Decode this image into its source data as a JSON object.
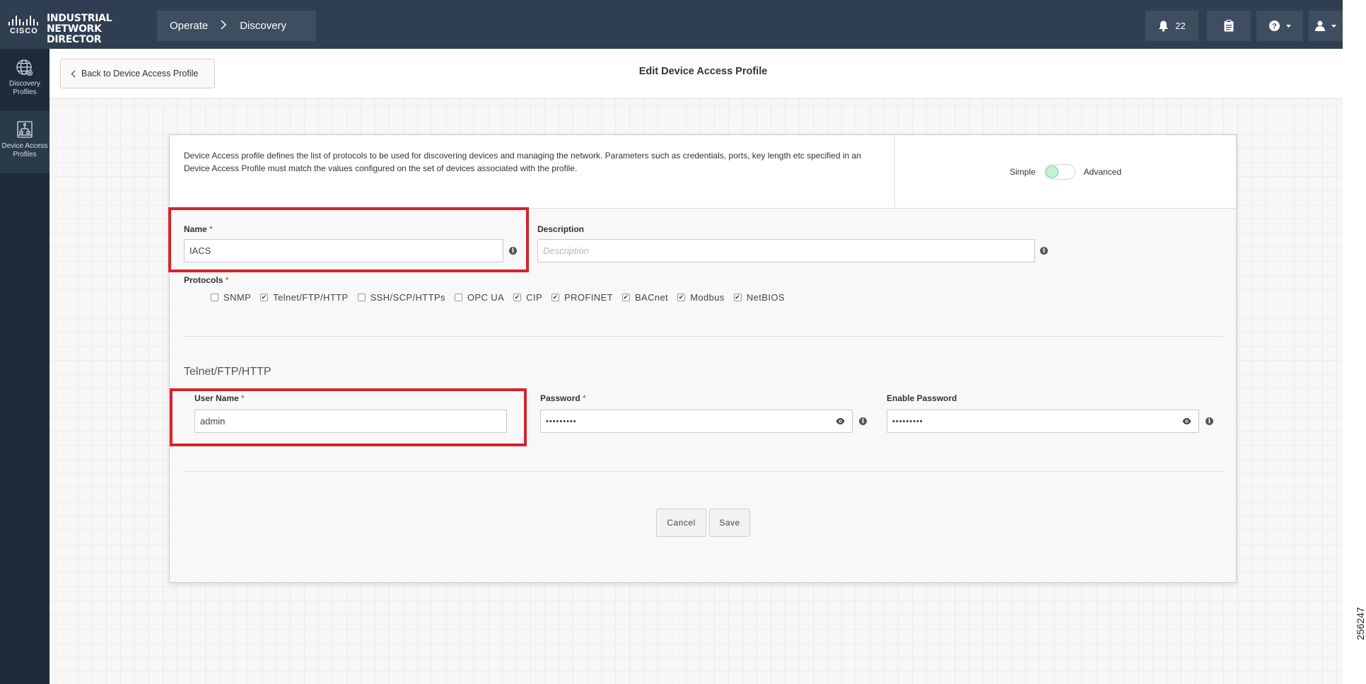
{
  "header": {
    "logo_brand": "CISCO",
    "logo_product_line1": "INDUSTRIAL",
    "logo_product_line2": "NETWORK DIRECTOR",
    "breadcrumb": [
      "Operate",
      "Discovery"
    ],
    "notifications_count": "22",
    "icons": [
      "bell-icon",
      "clipboard-icon",
      "help-icon",
      "user-icon"
    ]
  },
  "sidebar": {
    "items": [
      {
        "label_line1": "Discovery",
        "label_line2": "Profiles",
        "icon": "globe-icon",
        "active": false
      },
      {
        "label_line1": "Device Access",
        "label_line2": "Profiles",
        "icon": "device-icon",
        "active": true
      }
    ]
  },
  "page": {
    "back_label": "Back to Device Access Profile",
    "title": "Edit Device Access Profile"
  },
  "form": {
    "intro_text": "Device Access profile defines the list of protocols to be used for discovering devices and managing the network. Parameters such as credentials, ports, key length etc specified in an Device Access Profile must match the values configured on the set of devices associated with the profile.",
    "mode_simple": "Simple",
    "mode_advanced": "Advanced",
    "mode_selected": "Simple",
    "name_label": "Name",
    "name_value": "IACS",
    "description_label": "Description",
    "description_placeholder": "Description",
    "protocols_label": "Protocols",
    "protocols": [
      {
        "label": "SNMP",
        "checked": false
      },
      {
        "label": "Telnet/FTP/HTTP",
        "checked": true
      },
      {
        "label": "SSH/SCP/HTTPs",
        "checked": false
      },
      {
        "label": "OPC UA",
        "checked": false
      },
      {
        "label": "CIP",
        "checked": true
      },
      {
        "label": "PROFINET",
        "checked": true
      },
      {
        "label": "BACnet",
        "checked": true
      },
      {
        "label": "Modbus",
        "checked": true
      },
      {
        "label": "NetBIOS",
        "checked": true
      }
    ],
    "section_title": "Telnet/FTP/HTTP",
    "username_label": "User Name",
    "username_value": "admin",
    "password_label": "Password",
    "password_value": "•••••••••",
    "enable_password_label": "Enable Password",
    "enable_password_value": "•••••••••",
    "required_mark": "*",
    "cancel_label": "Cancel",
    "save_label": "Save"
  },
  "figure_id": "256247",
  "colors": {
    "topbar": "#2f3e51",
    "sidebar": "#1d2b3a",
    "highlight": "#d7232c",
    "toggle_knob": "#c9f0d6"
  }
}
